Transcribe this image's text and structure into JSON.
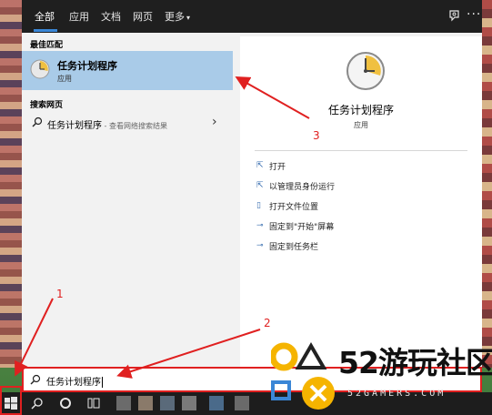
{
  "tabs": [
    "全部",
    "应用",
    "文档",
    "网页",
    "更多"
  ],
  "tabs_more_caret": "▾",
  "icons": {
    "feedback": "feedback-icon",
    "more": "more-options-icon",
    "app": "task-scheduler-clock-icon",
    "search": "search-icon"
  },
  "left": {
    "best_match_header": "最佳匹配",
    "best_match": {
      "title": "任务计划程序",
      "subtitle": "应用"
    },
    "web_header": "搜索网页",
    "web_item": {
      "query": "任务计划程序",
      "hint": " - 查看网络搜索结果"
    }
  },
  "right": {
    "title": "任务计划程序",
    "subtitle": "应用",
    "actions": [
      "打开",
      "以管理员身份运行",
      "打开文件位置",
      "固定到\"开始\"屏幕",
      "固定到任务栏"
    ]
  },
  "search_box": {
    "value": "任务计划程序"
  },
  "annotations": {
    "n1": "1",
    "n2": "2",
    "n3": "3"
  },
  "watermark": {
    "text": "52游玩社区",
    "sub": "52GAMERS.COM"
  },
  "colors": {
    "highlight": "#a9cbe8",
    "accent": "#3a86d6",
    "annotation": "#e02020",
    "watermark_yellow": "#f5b400"
  }
}
